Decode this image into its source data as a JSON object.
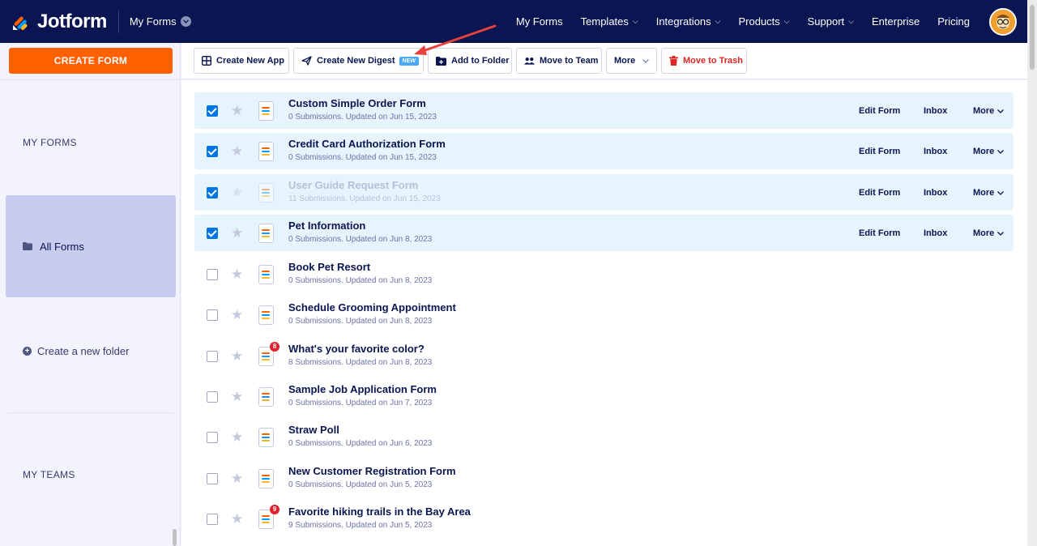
{
  "topnav": {
    "brand": "Jotform",
    "my_forms": "My Forms",
    "links": [
      {
        "label": "My Forms",
        "has_caret": false
      },
      {
        "label": "Templates",
        "has_caret": true
      },
      {
        "label": "Integrations",
        "has_caret": true
      },
      {
        "label": "Products",
        "has_caret": true
      },
      {
        "label": "Support",
        "has_caret": true
      },
      {
        "label": "Enterprise",
        "has_caret": false
      },
      {
        "label": "Pricing",
        "has_caret": false
      }
    ]
  },
  "sidebar": {
    "create_form": "CREATE FORM",
    "my_forms_title": "MY FORMS",
    "all_forms": "All Forms",
    "create_folder": "Create a new folder",
    "my_teams_title": "MY TEAMS"
  },
  "toolbar": {
    "create_app": "Create New App",
    "create_digest": "Create New Digest",
    "new_badge": "NEW",
    "add_folder": "Add to Folder",
    "move_team": "Move to Team",
    "more": "More",
    "trash": "Move to Trash"
  },
  "row_actions": {
    "edit": "Edit Form",
    "inbox": "Inbox",
    "more": "More"
  },
  "forms": [
    {
      "title": "Custom Simple Order Form",
      "subtitle": "0 Submissions. Updated on Jun 15, 2023",
      "checked": true,
      "faded": false,
      "badge": null
    },
    {
      "title": "Credit Card Authorization Form",
      "subtitle": "0 Submissions. Updated on Jun 15, 2023",
      "checked": true,
      "faded": false,
      "badge": null
    },
    {
      "title": "User Guide Request Form",
      "subtitle": "11 Submissions. Updated on Jun 15, 2023",
      "checked": true,
      "faded": true,
      "badge": null
    },
    {
      "title": "Pet Information",
      "subtitle": "0 Submissions. Updated on Jun 8, 2023",
      "checked": true,
      "faded": false,
      "badge": null
    },
    {
      "title": "Book Pet Resort",
      "subtitle": "0 Submissions. Updated on Jun 8, 2023",
      "checked": false,
      "faded": false,
      "badge": null
    },
    {
      "title": "Schedule Grooming Appointment",
      "subtitle": "0 Submissions. Updated on Jun 8, 2023",
      "checked": false,
      "faded": false,
      "badge": null
    },
    {
      "title": "What's your favorite color?",
      "subtitle": "8 Submissions. Updated on Jun 8, 2023",
      "checked": false,
      "faded": false,
      "badge": "8"
    },
    {
      "title": "Sample Job Application Form",
      "subtitle": "0 Submissions. Updated on Jun 7, 2023",
      "checked": false,
      "faded": false,
      "badge": null
    },
    {
      "title": "Straw Poll",
      "subtitle": "0 Submissions. Updated on Jun 6, 2023",
      "checked": false,
      "faded": false,
      "badge": null
    },
    {
      "title": "New Customer Registration Form",
      "subtitle": "0 Submissions. Updated on Jun 5, 2023",
      "checked": false,
      "faded": false,
      "badge": null
    },
    {
      "title": "Favorite hiking trails in the Bay Area",
      "subtitle": "9 Submissions. Updated on Jun 5, 2023",
      "checked": false,
      "faded": false,
      "badge": "9"
    }
  ],
  "colors": {
    "nav_bg": "#0a1551",
    "accent_orange": "#ff6100",
    "checkbox_blue": "#0075e3",
    "selected_row": "#e6f4fd",
    "trash_red": "#dc2626",
    "annotation_arrow": "#e8413c"
  }
}
